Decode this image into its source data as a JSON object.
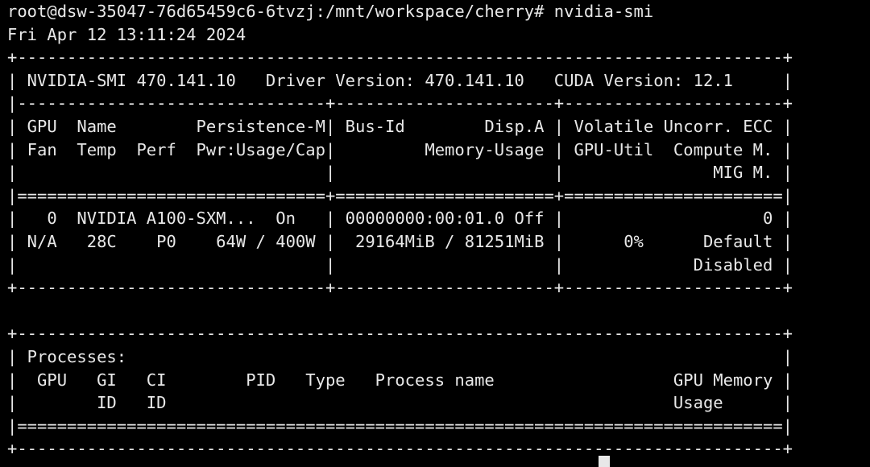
{
  "terminal": {
    "lines": [
      "root@dsw-35047-76d65459c6-6tvzj:/mnt/workspace/cherry# nvidia-smi",
      "Fri Apr 12 13:11:24 2024",
      "+-----------------------------------------------------------------------------+",
      "| NVIDIA-SMI 470.141.10   Driver Version: 470.141.10   CUDA Version: 12.1     |",
      "|-------------------------------+----------------------+----------------------+",
      "| GPU  Name        Persistence-M| Bus-Id        Disp.A | Volatile Uncorr. ECC |",
      "| Fan  Temp  Perf  Pwr:Usage/Cap|         Memory-Usage | GPU-Util  Compute M. |",
      "|                               |                      |               MIG M. |",
      "|===============================+======================+======================|",
      "|   0  NVIDIA A100-SXM...  On   | 00000000:00:01.0 Off |                    0 |",
      "| N/A   28C    P0    64W / 400W |  29164MiB / 81251MiB |      0%      Default |",
      "|                               |                      |             Disabled |",
      "+-------------------------------+----------------------+----------------------+",
      "",
      "+-----------------------------------------------------------------------------+",
      "| Processes:                                                                  |",
      "|  GPU   GI   CI        PID   Type   Process name                  GPU Memory |",
      "|        ID   ID                                                   Usage      |",
      "|=============================================================================|",
      "+-----------------------------------------------------------------------------+"
    ]
  },
  "colors": {
    "background": "#000000",
    "foreground": "#e8e8e8"
  }
}
